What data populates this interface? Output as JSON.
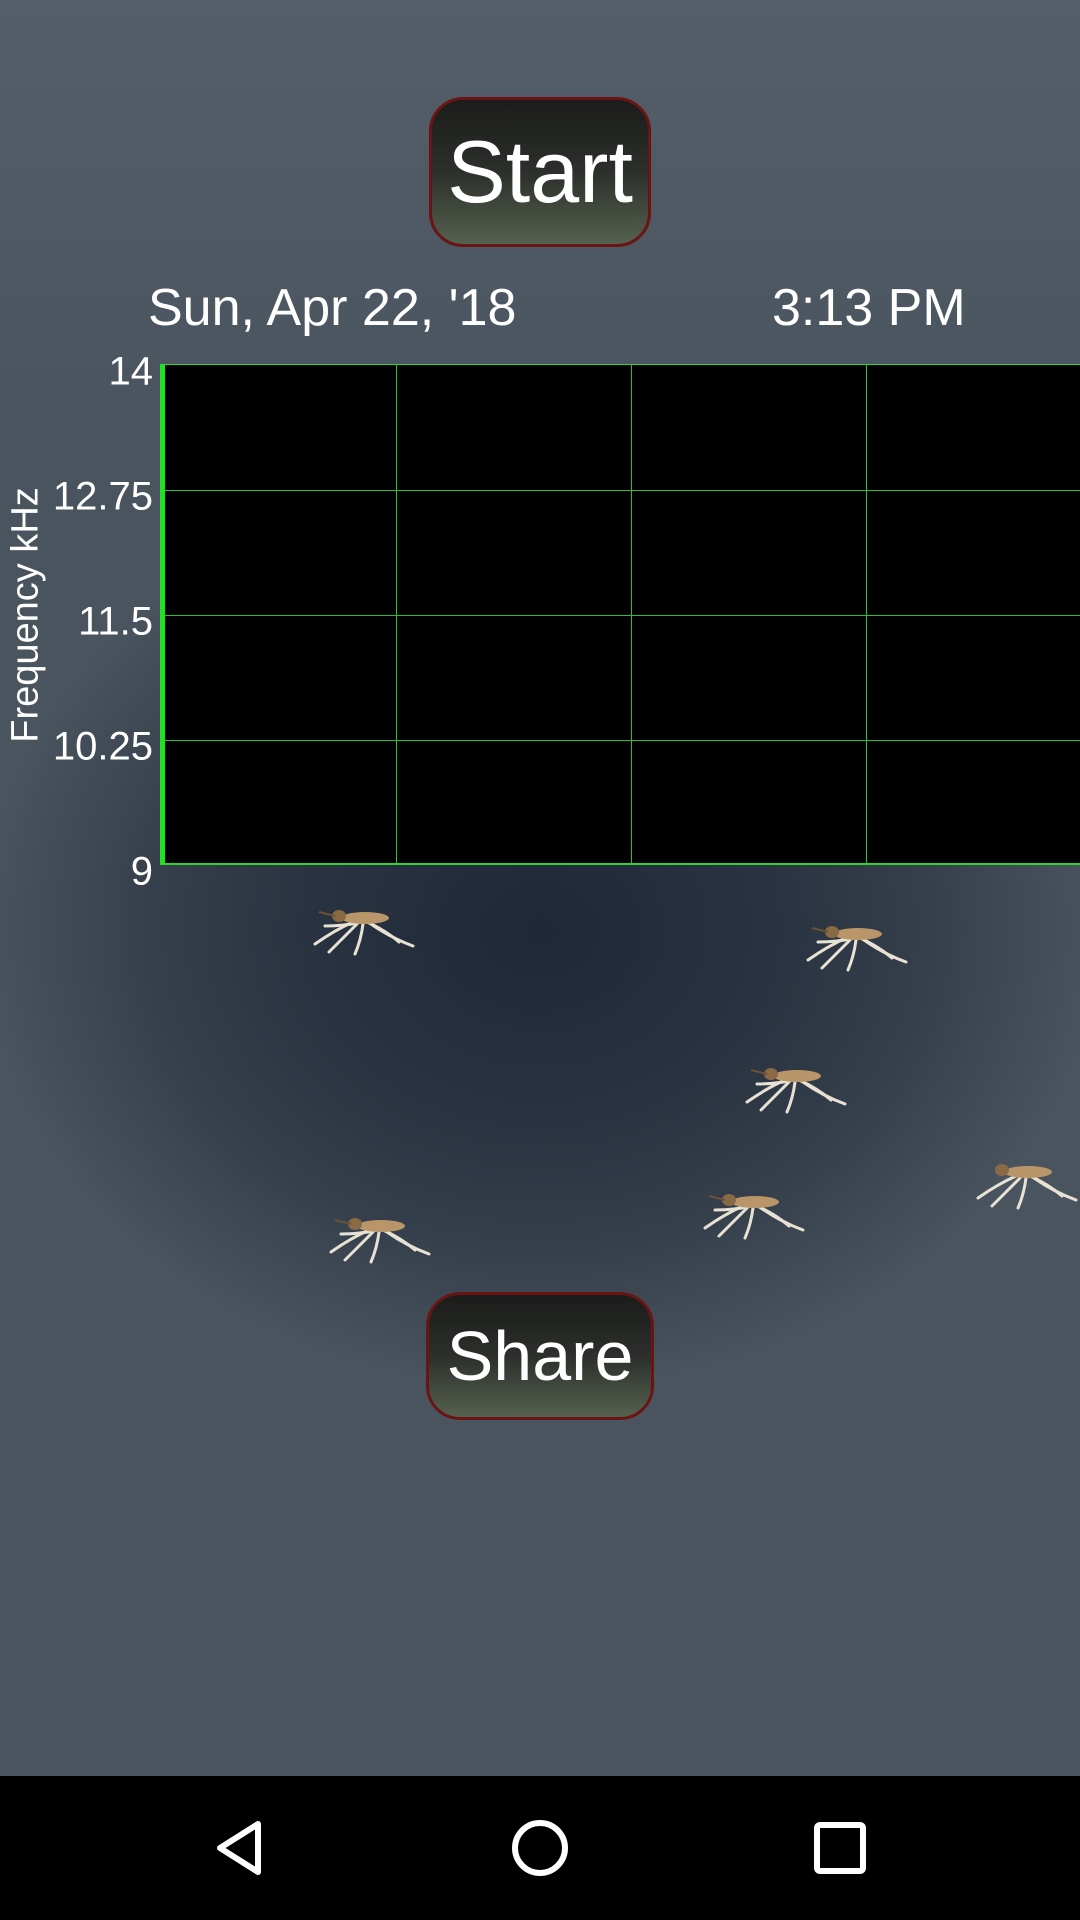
{
  "buttons": {
    "start_label": "Start",
    "share_label": "Share"
  },
  "header": {
    "date": "Sun, Apr 22, '18",
    "time": "3:13 PM"
  },
  "chart": {
    "ylabel": "Frequency kHz",
    "y_ticks": [
      "14",
      "12.75",
      "11.5",
      "10.25",
      "9"
    ]
  },
  "chart_data": {
    "type": "line",
    "title": "",
    "xlabel": "",
    "ylabel": "Frequency kHz",
    "ylim": [
      9,
      14
    ],
    "y_ticks": [
      14,
      12.75,
      11.5,
      10.25,
      9
    ],
    "grid": true,
    "series": []
  },
  "navbar": {
    "icons": [
      "back-icon",
      "home-icon",
      "recents-icon"
    ]
  },
  "colors": {
    "grid": "#2fbf2f",
    "plot_background": "#000000",
    "button_border": "#6a1414"
  }
}
